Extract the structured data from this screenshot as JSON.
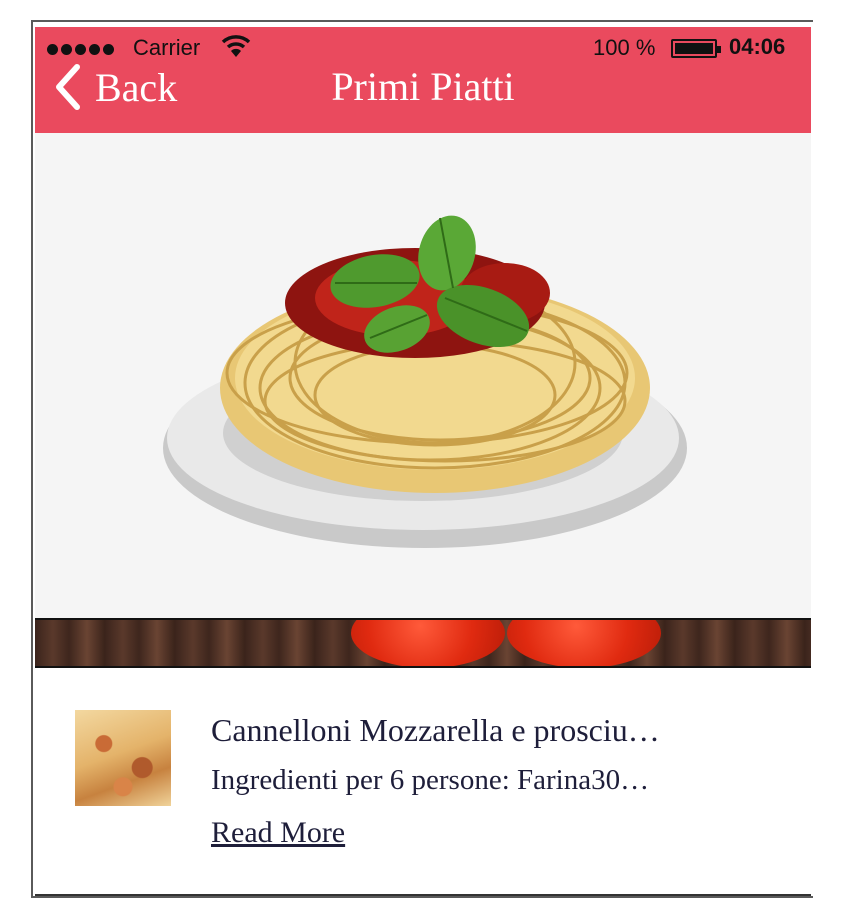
{
  "status_bar": {
    "carrier": "Carrier",
    "battery_percent": "100 %",
    "time": "04:06"
  },
  "nav": {
    "back_label": "Back",
    "title": "Primi Piatti"
  },
  "recipes": [
    {
      "title": "Cannelloni Mozzarella e prosciu…",
      "description": "Ingredienti per 6 persone: Farina30…",
      "read_more": "Read More"
    }
  ],
  "colors": {
    "header": "#ea4a5e",
    "text": "#1e1e3a",
    "hero_background": "#f5f5f5"
  },
  "icons": [
    "signal-dots-icon",
    "wifi-icon",
    "battery-icon",
    "chevron-left-icon"
  ]
}
